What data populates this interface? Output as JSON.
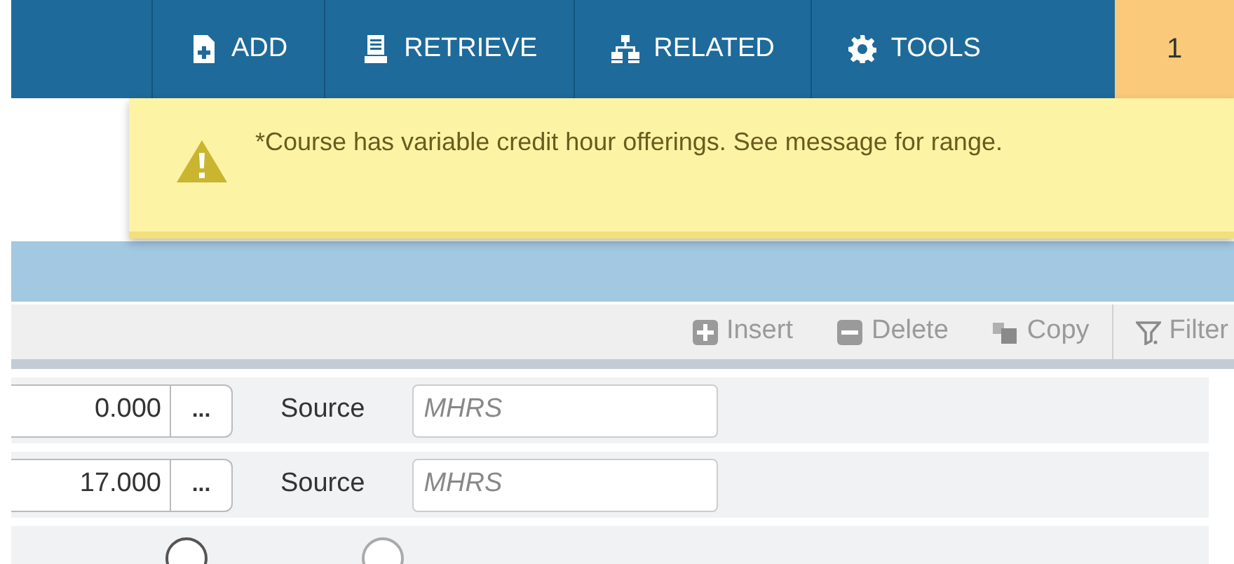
{
  "top_bar": {
    "buttons": [
      {
        "kind": "add",
        "label": "ADD"
      },
      {
        "kind": "retrieve",
        "label": "RETRIEVE"
      },
      {
        "kind": "related",
        "label": "RELATED"
      },
      {
        "kind": "tools",
        "label": "TOOLS"
      }
    ],
    "notification_count": "1"
  },
  "notification": {
    "message": "*Course has variable credit hour offerings. See message for range."
  },
  "toolbar": {
    "actions": [
      {
        "kind": "insert",
        "label": "Insert"
      },
      {
        "kind": "delete",
        "label": "Delete"
      },
      {
        "kind": "copy",
        "label": "Copy"
      },
      {
        "kind": "filter",
        "label": "Filter"
      }
    ]
  },
  "rows": [
    {
      "value": "0.000",
      "lookup": "...",
      "source_label": "Source",
      "source_value": "MHRS"
    },
    {
      "value": "17.000",
      "lookup": "...",
      "source_label": "Source",
      "source_value": "MHRS"
    }
  ]
}
